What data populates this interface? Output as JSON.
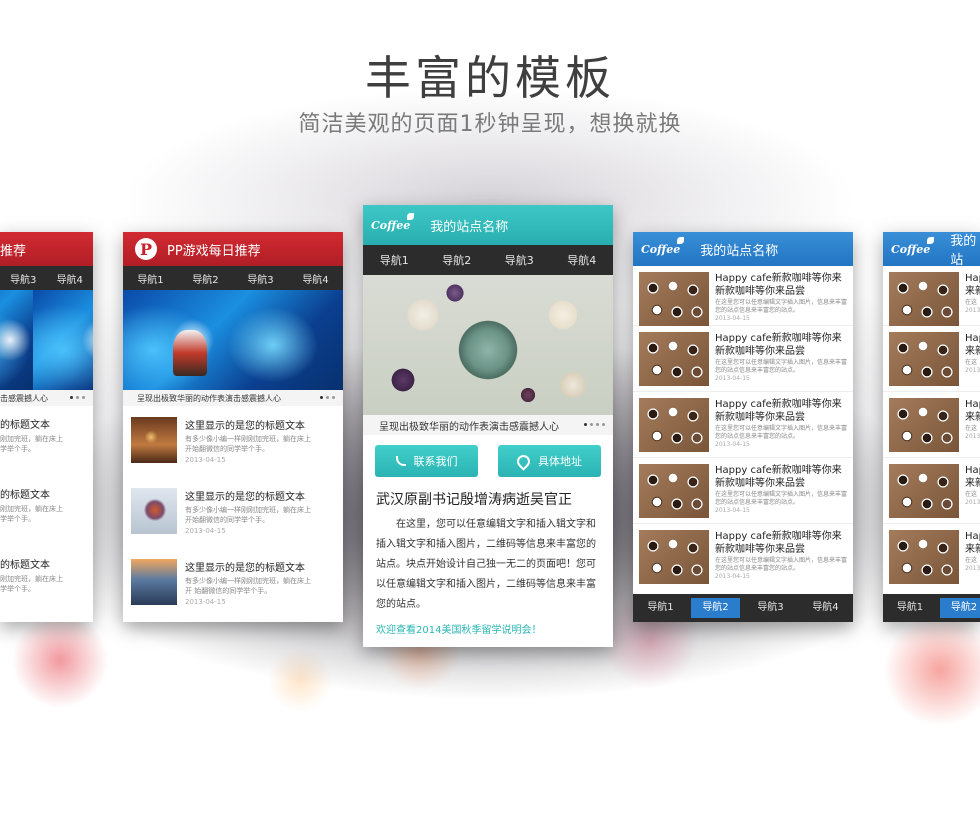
{
  "heading": {
    "title": "丰富的模板",
    "subtitle": "简洁美观的页面1秒钟呈现，想换就换"
  },
  "template_red": {
    "header_title": "PP游戏每日推荐",
    "header_title_partial": "推荐",
    "logo_letter": "P",
    "nav": [
      "导航1",
      "导航2",
      "导航3",
      "导航4"
    ],
    "caption": "呈现出极致华丽的动作表演击感震撼人心",
    "caption_partial": "击感震撼人心",
    "news": [
      {
        "title": "这里显示的是您的标题文本",
        "desc1": "有多少像小编一样刚刚加完班，躺在床上",
        "desc2": "开始翻微信的同学举个手。",
        "date": "2013-04-15"
      },
      {
        "title": "这里显示的是您的标题文本",
        "desc1": "有多少像小编一样刚刚加完班，躺在床上",
        "desc2": "开始翻微信的同学举个手。",
        "date": "2013-04-15"
      },
      {
        "title": "这里显示的是您的标题文本",
        "desc1": "有多少像小编一样刚刚加完班，躺在床上",
        "desc2": "开 始翻微信的同学举个手。",
        "date": "2013-04-15"
      }
    ],
    "partial_news": [
      {
        "title": "的标题文本",
        "desc1": "刚加完班，躺在床上",
        "desc2": "学举个手。"
      },
      {
        "title": "的标题文本",
        "desc1": "刚加完班，躺在床上",
        "desc2": "学举个手。"
      },
      {
        "title": "的标题文本",
        "desc1": "刚加完班，躺在床上",
        "desc2": "学举个手。"
      }
    ]
  },
  "template_teal": {
    "logo_text": "Coffee",
    "header_title": "我的站点名称",
    "nav": [
      "导航1",
      "导航2",
      "导航3",
      "导航4"
    ],
    "caption": "呈现出极致华丽的动作表演击感震撼人心",
    "contact_button": "联系我们",
    "address_button": "具体地址",
    "article_title": "武汉原副书记殷增涛病逝吴官正",
    "article_body": "在这里，您可以任意编辑文字和插入辑文字和插入辑文字和插入图片，二维码等信息来丰富您的站点。块点开始设计自己独一无二的页面吧！您可以任意编辑文字和插入图片，二维码等信息来丰富您的站点。",
    "article_link": "欢迎查看2014美国秋季留学说明会！"
  },
  "template_blue": {
    "logo_text": "Coffee",
    "header_title": "我的站点名称",
    "items": [
      {
        "title": "Happy cafe新款咖啡等你来新款咖啡等你来品尝",
        "desc": "在这里您可以任意编辑文字插入图片，信息来丰富您的站点信息来丰富您的站点。",
        "date": "2013-04-15"
      },
      {
        "title": "Happy cafe新款咖啡等你来新款咖啡等你来品尝",
        "desc": "在这里您可以任意编辑文字插入图片，信息来丰富您的站点信息来丰富您的站点。",
        "date": "2013-04-15"
      },
      {
        "title": "Happy cafe新款咖啡等你来新款咖啡等你来品尝",
        "desc": "在这里您可以任意编辑文字插入图片，信息来丰富您的站点信息来丰富您的站点。",
        "date": "2013-04-15"
      },
      {
        "title": "Happy cafe新款咖啡等你来新款咖啡等你来品尝",
        "desc": "在这里您可以任意编辑文字插入图片，信息来丰富您的站点信息来丰富您的站点。",
        "date": "2013-04-15"
      },
      {
        "title": "Happy cafe新款咖啡等你来新款咖啡等你来品尝",
        "desc": "在这里您可以任意编辑文字插入图片，信息来丰富您的站点信息来丰富您的站点。",
        "date": "2013-04-15"
      }
    ],
    "bottom_nav": [
      "导航1",
      "导航2",
      "导航3",
      "导航4"
    ],
    "active_nav_index": 1,
    "partial_header_title": "我的站",
    "partial_item_title": "Happ",
    "partial_item_title2": "来新",
    "partial_item_desc": "在这",
    "partial_item_date": "2013",
    "partial_bottom_nav": [
      "导航1",
      "导航2"
    ]
  },
  "colors": {
    "red_header": "#c8232b",
    "teal_header": "#33bcbc",
    "blue_header": "#2a7ccc",
    "nav_bar": "#2c2c2c"
  }
}
